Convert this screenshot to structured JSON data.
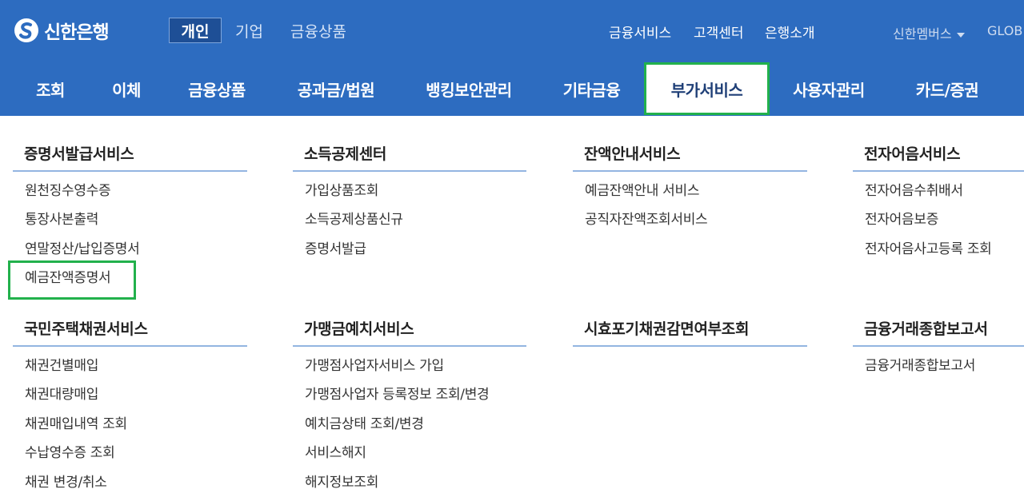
{
  "header": {
    "brand": "신한은행",
    "segments": [
      "개인",
      "기업",
      "금융상품"
    ],
    "utility": [
      "금융서비스",
      "고객센터",
      "은행소개"
    ],
    "members": "신한멤버스",
    "global": "GLOB"
  },
  "gnb": [
    "조회",
    "이체",
    "금융상품",
    "공과금/법원",
    "뱅킹보안관리",
    "기타금융",
    "부가서비스",
    "사용자관리",
    "카드/증권"
  ],
  "gnb_selected": "부가서비스",
  "sections": [
    {
      "title": "증명서발급서비스",
      "links": [
        "원천징수영수증",
        "통장사본출력",
        "연말정산/납입증명서",
        "예금잔액증명서"
      ]
    },
    {
      "title": "소득공제센터",
      "links": [
        "가입상품조회",
        "소득공제상품신규",
        "증명서발급"
      ]
    },
    {
      "title": "잔액안내서비스",
      "links": [
        "예금잔액안내 서비스",
        "공직자잔액조회서비스"
      ]
    },
    {
      "title": "전자어음서비스",
      "links": [
        "전자어음수취배서",
        "전자어음보증",
        "전자어음사고등록 조회"
      ]
    },
    {
      "title": "국민주택채권서비스",
      "links": [
        "채권건별매입",
        "채권대량매입",
        "채권매입내역 조회",
        "수납영수증 조회",
        "채권 변경/취소"
      ]
    },
    {
      "title": "가맹금예치서비스",
      "links": [
        "가맹점사업자서비스 가입",
        "가맹점사업자 등록정보 조회/변경",
        "예치금상태 조회/변경",
        "서비스해지",
        "해지정보조회"
      ]
    },
    {
      "title": "시효포기채권감면여부조회",
      "links": []
    },
    {
      "title": "금융거래종합보고서",
      "links": [
        "금융거래종합보고서"
      ]
    }
  ],
  "highlight_color": "#22b14c",
  "brand_color": "#2d6cc0"
}
